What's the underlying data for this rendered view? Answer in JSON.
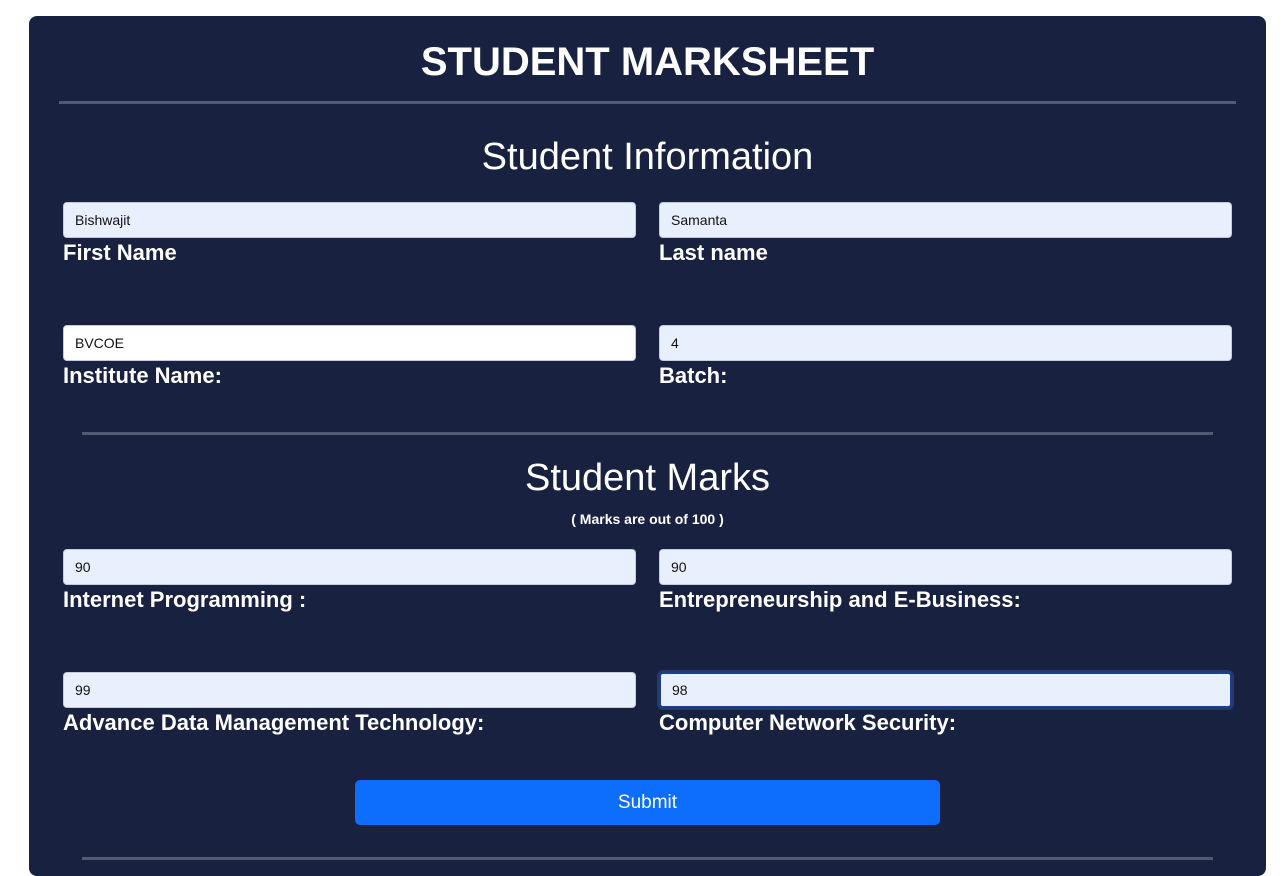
{
  "page": {
    "title": "STUDENT MARKSHEET"
  },
  "info_section": {
    "heading": "Student Information",
    "fields": [
      {
        "label": "First Name",
        "value": "Bishwajit"
      },
      {
        "label": "Last name",
        "value": "Samanta"
      },
      {
        "label": "Institute Name:",
        "value": "BVCOE"
      },
      {
        "label": "Batch:",
        "value": "4"
      }
    ]
  },
  "marks_section": {
    "heading": "Student Marks",
    "note": "( Marks are out of 100 )",
    "fields": [
      {
        "label": "Internet Programming :",
        "value": "90"
      },
      {
        "label": "Entrepreneurship and E-Business:",
        "value": "90"
      },
      {
        "label": "Advance Data Management Technology:",
        "value": "99"
      },
      {
        "label": "Computer Network Security:",
        "value": "98"
      }
    ]
  },
  "submit": {
    "label": "Submit"
  },
  "colors": {
    "card_background": "#182240",
    "input_autofill_background": "#e8f0fe",
    "submit_button": "#0d6efd"
  }
}
